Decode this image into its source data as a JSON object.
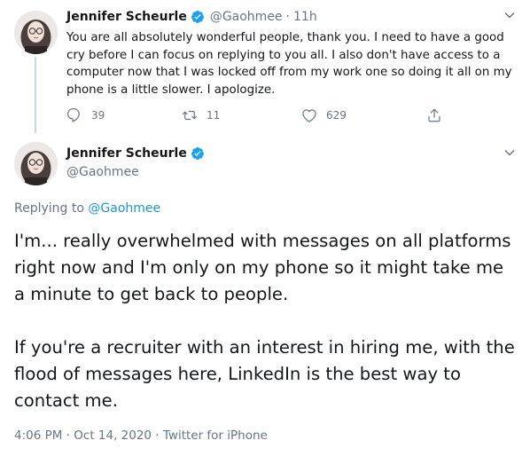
{
  "colors": {
    "accent": "#1da1f2",
    "link": "#1b95e0",
    "muted": "#657786",
    "text": "#14171a",
    "divider": "#ccd6dd"
  },
  "tweet1": {
    "name": "Jennifer Scheurle",
    "handle": "@Gaohmee",
    "separator": "·",
    "time": "11h",
    "text": "You are all absolutely wonderful people, thank you. I need to have a good cry before I can focus on replying to you all. I also don't have access to a computer now that I was locked off from my work one so doing it all on my phone is a little slower. I apologize.",
    "replies": "39",
    "retweets": "11",
    "likes": "629",
    "icons": {
      "reply": "reply-icon",
      "retweet": "retweet-icon",
      "like": "heart-icon",
      "share": "share-icon",
      "more": "chevron-down-icon",
      "verified": "verified-badge-icon"
    }
  },
  "tweet2": {
    "name": "Jennifer Scheurle",
    "handle": "@Gaohmee",
    "replying_prefix": "Replying to",
    "replying_handle": "@Gaohmee",
    "paragraph1": "I'm... really overwhelmed with messages on all platforms right now and I'm only on my phone so it might take me a minute to get back to people.",
    "paragraph2": "If you're a recruiter with an interest in hiring me, with the flood of messages here, LinkedIn is the best way to contact me.",
    "meta": "4:06 PM · Oct 14, 2020 · Twitter for iPhone"
  }
}
